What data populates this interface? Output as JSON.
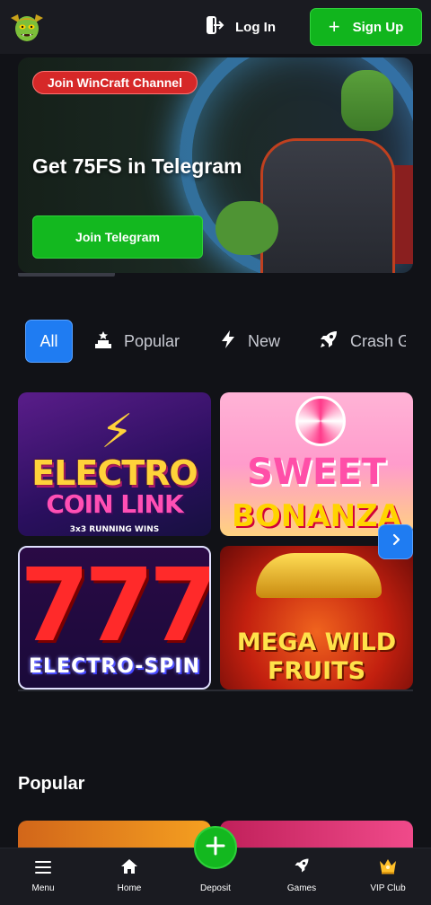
{
  "header": {
    "login_label": "Log In",
    "signup_label": "Sign Up"
  },
  "banner": {
    "chip_label": "Join WinCraft Channel",
    "title": "Get 75FS in Telegram",
    "button_label": "Join Telegram"
  },
  "tabs": [
    {
      "label": "All",
      "icon": "none",
      "active": true
    },
    {
      "label": "Popular",
      "icon": "podium-icon"
    },
    {
      "label": "New",
      "icon": "lightning-icon"
    },
    {
      "label": "Crash G",
      "icon": "rocket-icon"
    }
  ],
  "games": [
    {
      "line1": "ELECTRO",
      "line2": "COIN LINK",
      "line3": "3x3 RUNNING WINS"
    },
    {
      "line1": "SWEET",
      "line2": "BONANZA"
    },
    {
      "line1": "777",
      "line2": "ELECTRO-SPIN"
    },
    {
      "line1": "MEGA WILD",
      "line2": "FRUITS"
    }
  ],
  "popular": {
    "title": "Popular"
  },
  "bottom_nav": [
    {
      "label": "Menu",
      "icon": "menu-icon"
    },
    {
      "label": "Home",
      "icon": "home-icon"
    },
    {
      "label": "Deposit",
      "icon": "plus-icon"
    },
    {
      "label": "Games",
      "icon": "rocket-icon"
    },
    {
      "label": "VIP Club",
      "icon": "crown-icon"
    }
  ],
  "colors": {
    "accent_green": "#13b81f",
    "accent_blue": "#1f7cf2",
    "chip_red": "#d62828",
    "background": "#111217"
  }
}
